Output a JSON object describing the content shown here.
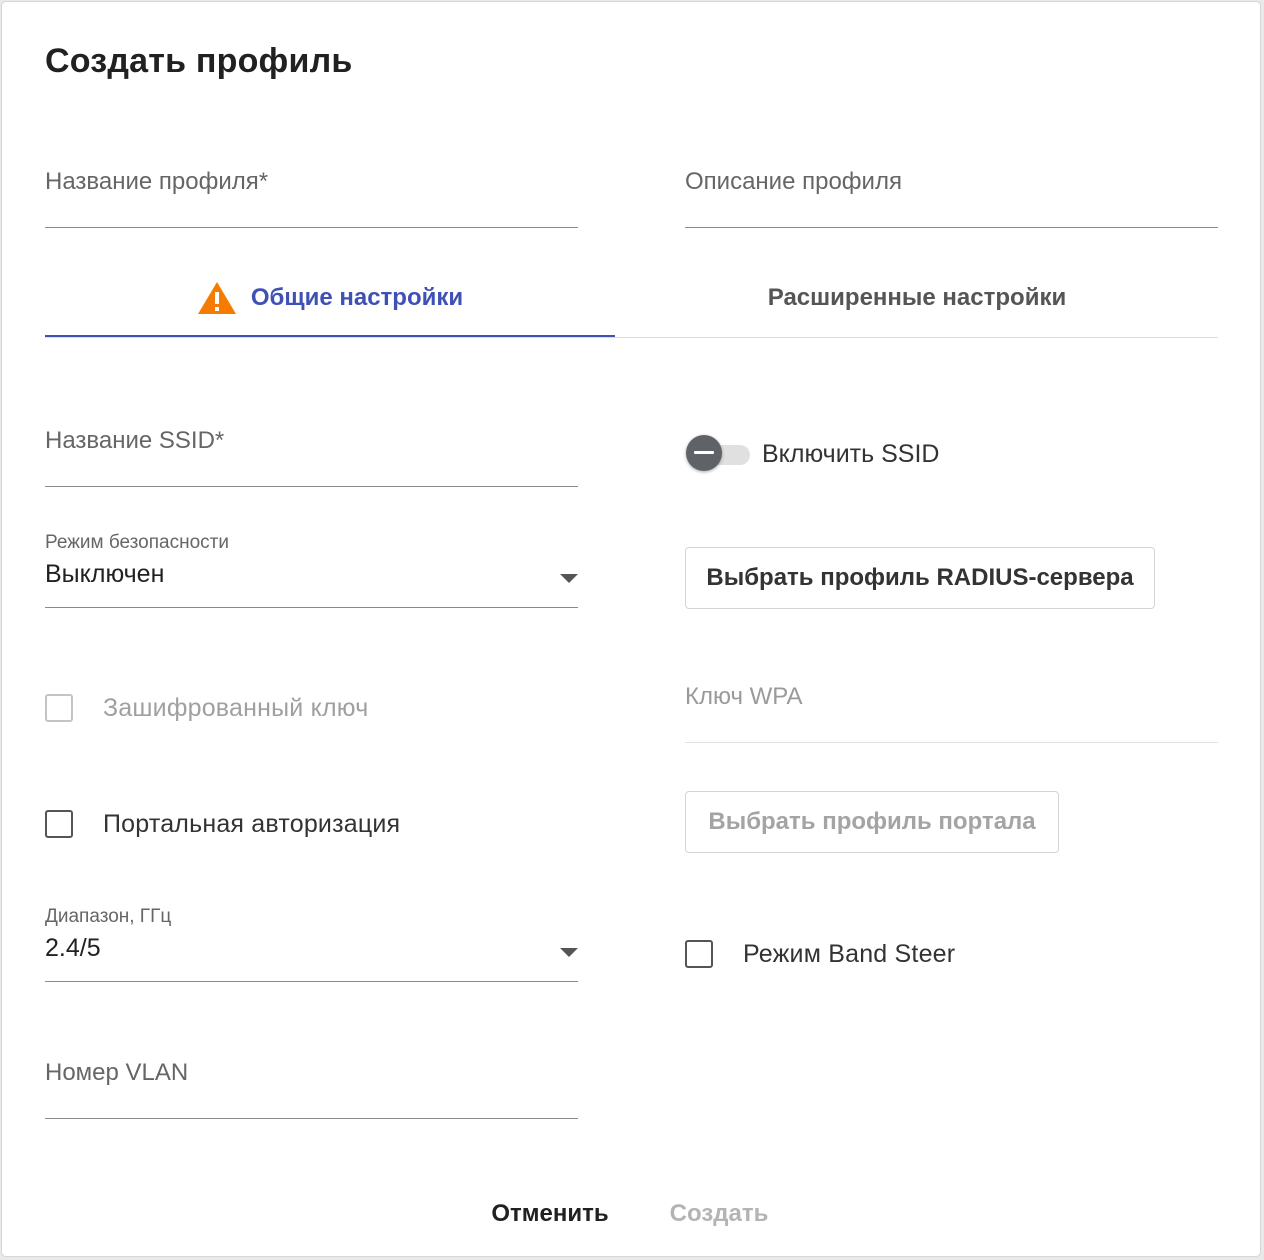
{
  "dialog": {
    "title": "Создать профиль"
  },
  "profile": {
    "name_label": "Название профиля*",
    "description_label": "Описание профиля"
  },
  "tabs": [
    {
      "label": "Общие настройки",
      "active": true,
      "warning_icon": "warning-triangle-icon",
      "warning_color": "#f57c00"
    },
    {
      "label": "Расширенные настройки",
      "active": false
    }
  ],
  "general": {
    "ssid_label": "Название SSID*",
    "enable_ssid_label": "Включить SSID",
    "security_mode": {
      "label": "Режим безопасности",
      "value": "Выключен"
    },
    "radius_button": "Выбрать профиль RADIUS-сервера",
    "encrypted_key_label": "Зашифрованный ключ",
    "wpa_key_label": "Ключ WPA",
    "portal_auth_label": "Портальная авторизация",
    "portal_profile_button": "Выбрать профиль портала",
    "band": {
      "label": "Диапазон, ГГц",
      "value": "2.4/5"
    },
    "band_steer_label": "Режим Band Steer",
    "vlan_label": "Номер VLAN"
  },
  "actions": {
    "cancel": "Отменить",
    "create": "Создать"
  },
  "colors": {
    "accent": "#3f51b5",
    "warning": "#f57c00"
  }
}
